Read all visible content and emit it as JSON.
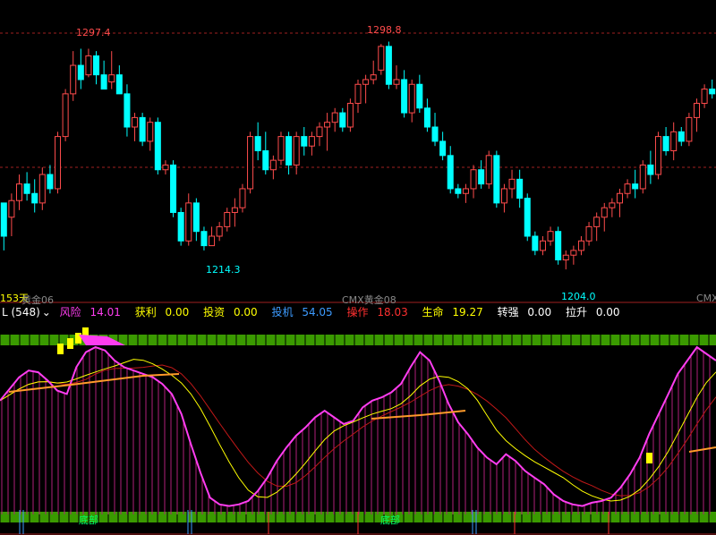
{
  "price_panel": {
    "high_label_1": "1297.4",
    "high_label_2": "1298.8",
    "low_label_1": "1214.3",
    "low_label_2": "1204.0",
    "period_label": "153天",
    "contract_labels": [
      "黄金06",
      "CMX黄金08",
      "CMX"
    ]
  },
  "indicator_legend": {
    "name": "L (548)",
    "items": [
      {
        "label": "风险",
        "value": "14.01",
        "color": "#ff3df0"
      },
      {
        "label": "获利",
        "value": "0.00",
        "color": "#ffff00"
      },
      {
        "label": "投资",
        "value": "0.00",
        "color": "#ffff00"
      },
      {
        "label": "投机",
        "value": "54.05",
        "color": "#3d9bff"
      },
      {
        "label": "操作",
        "value": "18.03",
        "color": "#ff3030"
      },
      {
        "label": "生命",
        "value": "19.27",
        "color": "#ffff00"
      },
      {
        "label": "转强",
        "value": "0.00",
        "color": "#ffffff"
      },
      {
        "label": "拉升",
        "value": "0.00",
        "color": "#ffffff"
      }
    ]
  },
  "bottom_markers": {
    "signal_text": "底部"
  },
  "colors": {
    "up_candle": "#ff4c4c",
    "down_candle": "#00ffff",
    "grid": "#a02020",
    "risk_line": "#ff3df0",
    "yellow_ma": "#ffff00",
    "red_ma": "#c01818",
    "green_band": "#3a9a00"
  },
  "chart_data": {
    "type": "candlestick",
    "y_range": [
      1195,
      1310
    ],
    "candles": [
      [
        1232,
        1232,
        1212,
        1218
      ],
      [
        1226,
        1236,
        1218,
        1233
      ],
      [
        1233,
        1244,
        1229,
        1240
      ],
      [
        1240,
        1245,
        1233,
        1236
      ],
      [
        1236,
        1242,
        1228,
        1232
      ],
      [
        1232,
        1247,
        1229,
        1244
      ],
      [
        1244,
        1248,
        1236,
        1238
      ],
      [
        1238,
        1262,
        1236,
        1260
      ],
      [
        1260,
        1280,
        1258,
        1278
      ],
      [
        1278,
        1296,
        1275,
        1290
      ],
      [
        1290,
        1297,
        1280,
        1284
      ],
      [
        1286,
        1297,
        1285,
        1294
      ],
      [
        1294,
        1296,
        1282,
        1286
      ],
      [
        1286,
        1292,
        1280,
        1280
      ],
      [
        1283,
        1296,
        1280,
        1286
      ],
      [
        1286,
        1290,
        1278,
        1278
      ],
      [
        1278,
        1282,
        1260,
        1264
      ],
      [
        1264,
        1270,
        1258,
        1268
      ],
      [
        1268,
        1270,
        1256,
        1258
      ],
      [
        1258,
        1268,
        1254,
        1266
      ],
      [
        1266,
        1268,
        1244,
        1246
      ],
      [
        1246,
        1250,
        1244,
        1248
      ],
      [
        1248,
        1250,
        1226,
        1228
      ],
      [
        1228,
        1230,
        1214,
        1216
      ],
      [
        1216,
        1236,
        1214,
        1232
      ],
      [
        1232,
        1234,
        1216,
        1220
      ],
      [
        1220,
        1222,
        1212,
        1214
      ],
      [
        1214,
        1222,
        1214,
        1218
      ],
      [
        1218,
        1224,
        1216,
        1222
      ],
      [
        1222,
        1230,
        1220,
        1228
      ],
      [
        1228,
        1234,
        1222,
        1230
      ],
      [
        1230,
        1240,
        1228,
        1238
      ],
      [
        1238,
        1262,
        1236,
        1260
      ],
      [
        1260,
        1266,
        1250,
        1254
      ],
      [
        1254,
        1262,
        1244,
        1246
      ],
      [
        1246,
        1252,
        1242,
        1250
      ],
      [
        1250,
        1262,
        1248,
        1260
      ],
      [
        1260,
        1262,
        1244,
        1248
      ],
      [
        1248,
        1262,
        1244,
        1260
      ],
      [
        1260,
        1264,
        1252,
        1256
      ],
      [
        1256,
        1262,
        1252,
        1260
      ],
      [
        1260,
        1266,
        1256,
        1264
      ],
      [
        1264,
        1270,
        1254,
        1266
      ],
      [
        1266,
        1272,
        1262,
        1270
      ],
      [
        1270,
        1272,
        1262,
        1264
      ],
      [
        1264,
        1276,
        1262,
        1274
      ],
      [
        1274,
        1284,
        1270,
        1282
      ],
      [
        1282,
        1286,
        1274,
        1284
      ],
      [
        1284,
        1292,
        1282,
        1286
      ],
      [
        1288,
        1299,
        1286,
        1298
      ],
      [
        1298,
        1300,
        1280,
        1282
      ],
      [
        1282,
        1290,
        1280,
        1284
      ],
      [
        1284,
        1288,
        1268,
        1270
      ],
      [
        1270,
        1284,
        1266,
        1282
      ],
      [
        1282,
        1286,
        1270,
        1272
      ],
      [
        1272,
        1276,
        1262,
        1264
      ],
      [
        1264,
        1270,
        1256,
        1258
      ],
      [
        1258,
        1262,
        1250,
        1252
      ],
      [
        1252,
        1256,
        1236,
        1238
      ],
      [
        1238,
        1240,
        1234,
        1236
      ],
      [
        1236,
        1240,
        1232,
        1238
      ],
      [
        1238,
        1248,
        1234,
        1246
      ],
      [
        1246,
        1250,
        1238,
        1240
      ],
      [
        1240,
        1254,
        1238,
        1252
      ],
      [
        1252,
        1254,
        1230,
        1232
      ],
      [
        1232,
        1240,
        1228,
        1238
      ],
      [
        1238,
        1246,
        1234,
        1242
      ],
      [
        1242,
        1246,
        1230,
        1234
      ],
      [
        1234,
        1236,
        1216,
        1218
      ],
      [
        1218,
        1220,
        1210,
        1212
      ],
      [
        1212,
        1218,
        1210,
        1216
      ],
      [
        1216,
        1222,
        1214,
        1220
      ],
      [
        1220,
        1222,
        1206,
        1208
      ],
      [
        1208,
        1212,
        1204,
        1210
      ],
      [
        1210,
        1214,
        1206,
        1212
      ],
      [
        1212,
        1218,
        1210,
        1216
      ],
      [
        1216,
        1224,
        1214,
        1222
      ],
      [
        1222,
        1228,
        1216,
        1226
      ],
      [
        1226,
        1232,
        1220,
        1230
      ],
      [
        1230,
        1234,
        1226,
        1232
      ],
      [
        1232,
        1238,
        1226,
        1236
      ],
      [
        1236,
        1242,
        1234,
        1240
      ],
      [
        1240,
        1246,
        1234,
        1238
      ],
      [
        1238,
        1250,
        1236,
        1248
      ],
      [
        1248,
        1254,
        1240,
        1244
      ],
      [
        1244,
        1262,
        1242,
        1260
      ],
      [
        1260,
        1264,
        1252,
        1254
      ],
      [
        1254,
        1266,
        1250,
        1262
      ],
      [
        1262,
        1264,
        1256,
        1258
      ],
      [
        1258,
        1270,
        1256,
        1268
      ],
      [
        1268,
        1276,
        1262,
        1274
      ],
      [
        1274,
        1282,
        1272,
        1280
      ],
      [
        1280,
        1284,
        1276,
        1278
      ]
    ],
    "risk_values": [
      68,
      75,
      82,
      86,
      85,
      80,
      74,
      72,
      88,
      97,
      100,
      98,
      92,
      88,
      86,
      84,
      82,
      78,
      72,
      60,
      42,
      25,
      10,
      6,
      5,
      6,
      8,
      14,
      22,
      32,
      40,
      47,
      52,
      58,
      62,
      58,
      54,
      56,
      64,
      68,
      70,
      73,
      78,
      88,
      97,
      92,
      80,
      66,
      55,
      48,
      40,
      34,
      30,
      36,
      32,
      26,
      22,
      18,
      12,
      8,
      6,
      5,
      7,
      8,
      10,
      16,
      24,
      34,
      48,
      60,
      72,
      84,
      92,
      100,
      96,
      92
    ]
  }
}
